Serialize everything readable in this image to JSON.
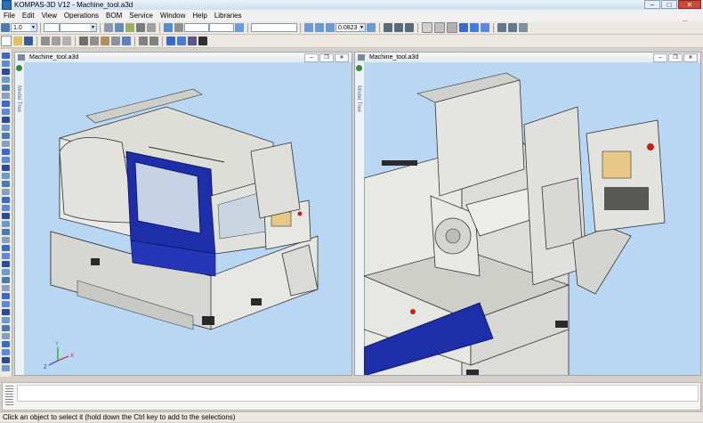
{
  "window": {
    "title": "KOMPAS-3D V12 - Machine_tool.a3d",
    "minimize": "–",
    "maximize": "□",
    "close": "✕"
  },
  "menu": {
    "items": [
      "File",
      "Edit",
      "View",
      "Operations",
      "BOM",
      "Service",
      "Window",
      "Help",
      "Libraries"
    ]
  },
  "mdi_controls": {
    "minimize": "–",
    "restore": "❐",
    "close": "✕"
  },
  "toolbar": {
    "step_value": "1.0",
    "zoom_value": "0.0823"
  },
  "left_window": {
    "title": "Machine_tool.a3d",
    "model_tree_label": "Model Tree",
    "axis_labels": {
      "x": "X",
      "y": "Y",
      "z": "Z"
    }
  },
  "right_window": {
    "title": "Machine_tool.a3d",
    "model_tree_label": "Model Tree"
  },
  "status": {
    "text": "Click an object to select it (hold down the Ctrl key to add to the selections)"
  },
  "colors": {
    "viewport_bg": "#b9d7f2",
    "machine_blue": "#1e2ea8",
    "machine_gray": "#d8d8d4"
  }
}
